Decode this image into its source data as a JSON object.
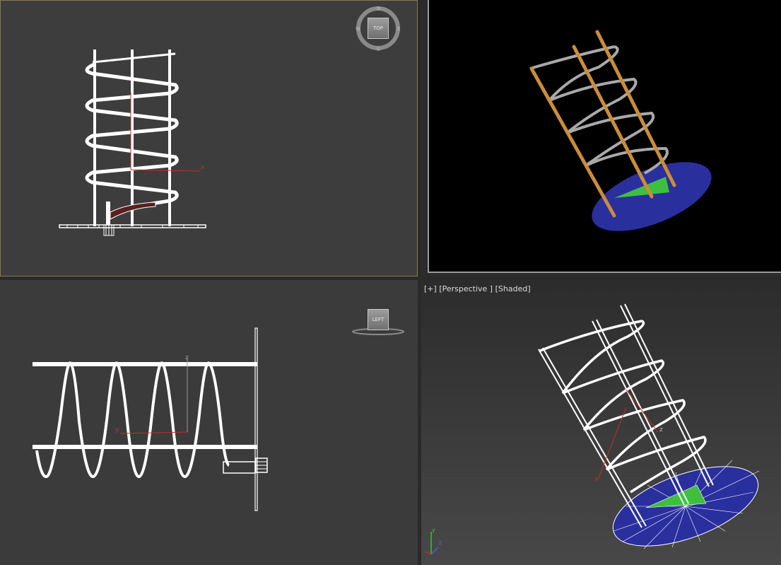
{
  "viewports": {
    "top": {
      "viewcube_label": "TOP",
      "compass": {
        "north": "N",
        "south": "S",
        "east": "E",
        "west": "W"
      },
      "axis_x": "x"
    },
    "camera": {},
    "left": {
      "viewcube_label": "LEFT",
      "axis_y": "y",
      "axis_z": "z"
    },
    "perspective": {
      "label_plus": "[+]",
      "label_view": "[Perspective ]",
      "label_shading": "[Shaded]",
      "axis_x": "x",
      "axis_z": "z",
      "gizmo": {
        "y": "y",
        "z": "z"
      }
    }
  },
  "colors": {
    "viewport_bg": "#3d3d3d",
    "wire": "#ffffff",
    "active_border": "#8a7a45",
    "disc_blue": "#2a2f9e",
    "cone_green": "#3ec03e",
    "rod_orange": "#c98d3a",
    "spring_grey": "#a9a9a9",
    "axis_red": "#c0302a"
  }
}
